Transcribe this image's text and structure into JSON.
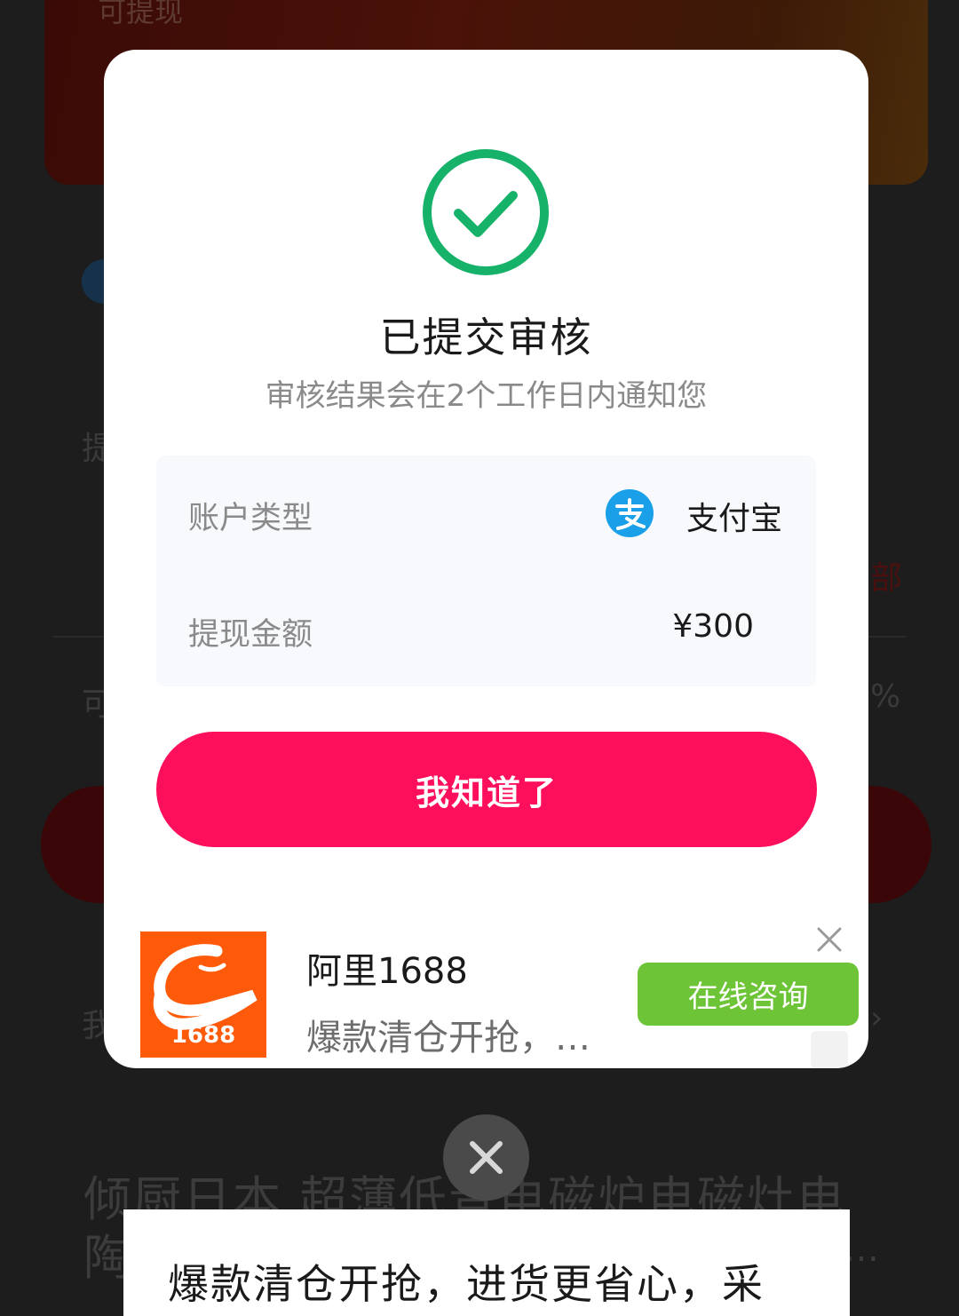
{
  "background": {
    "banner_title": "可提现",
    "fragment_1": "提",
    "fragment_2": "可",
    "fragment_3": "我",
    "fragment_4": "部",
    "fragment_5": "%",
    "product_title": "倾厨日本 超薄低音电磁炉电磁灶电陶炉",
    "product_ellipsis": "…"
  },
  "modal": {
    "title": "已提交审核",
    "subtitle": "审核结果会在2个工作日内通知您",
    "account_label": "账户类型",
    "account_value": "支付宝",
    "amount_label": "提现金额",
    "amount_value": "¥300",
    "confirm_label": "我知道了",
    "icon_success": "check-circle-icon",
    "icon_alipay": "alipay-icon"
  },
  "ad": {
    "logo_text": "1688",
    "title": "阿里1688",
    "description": "爆款清仓开抢，…",
    "cta_label": "在线咨询",
    "icon_close": "close-icon"
  },
  "bottom_sheet": {
    "text": "爆款清仓开抢，进货更省心，采"
  },
  "colors": {
    "accent": "#fe0f5b",
    "success": "#17b26a",
    "cta_green": "#6cc436",
    "alipay_blue": "#1aa0e8",
    "logo_orange": "#ff5a0a"
  }
}
